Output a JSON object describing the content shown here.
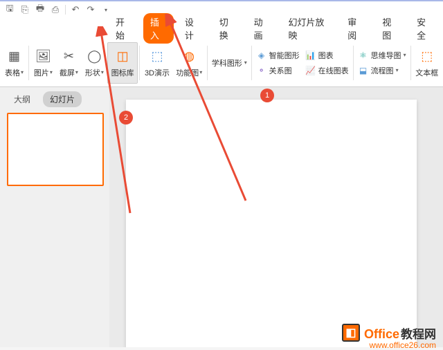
{
  "menubar": {
    "items": [
      "开始",
      "插入",
      "设计",
      "切换",
      "动画",
      "幻灯片放映",
      "审阅",
      "视图",
      "安全"
    ],
    "activeIndex": 1
  },
  "ribbon": {
    "table": "表格",
    "picture": "图片",
    "screenshot": "截屏",
    "shapes": "形状",
    "iconlib": "图标库",
    "demo3d": "3D演示",
    "funcchart": "功能图",
    "subjectshape": "学科图形",
    "smartart": "智能图形",
    "relation": "关系图",
    "chart": "图表",
    "onlinechart": "在线图表",
    "mindmap": "思维导图",
    "flowchart": "流程图",
    "textbox": "文本框"
  },
  "sidebar": {
    "outline": "大纲",
    "slides": "幻灯片"
  },
  "annotations": {
    "badge1": "1",
    "badge2": "2"
  },
  "watermark": {
    "brand_en": "Office",
    "brand_zh": "教程网",
    "url": "www.office26.com"
  }
}
